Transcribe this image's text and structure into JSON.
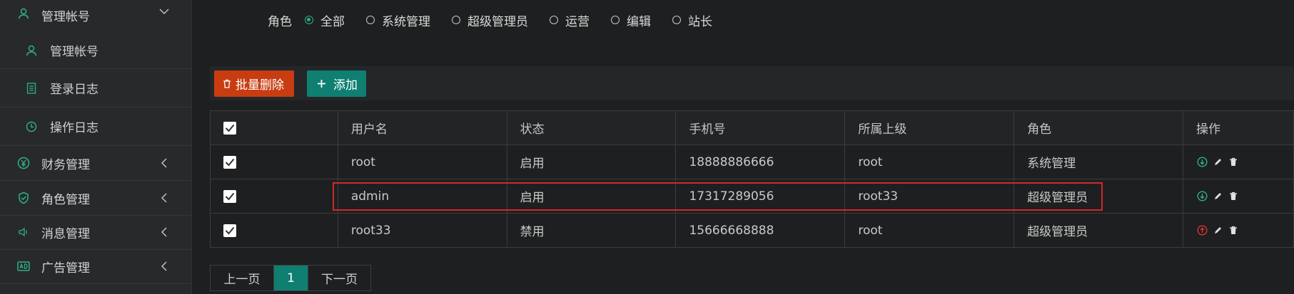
{
  "sidebar": {
    "top": {
      "label": "管理帐号",
      "icon": "user-icon"
    },
    "sub_items": [
      {
        "label": "管理帐号",
        "icon": "user-icon"
      },
      {
        "label": "登录日志",
        "icon": "document-icon"
      },
      {
        "label": "操作日志",
        "icon": "clock-icon"
      }
    ],
    "items": [
      {
        "label": "财务管理",
        "icon": "yen-icon"
      },
      {
        "label": "角色管理",
        "icon": "shield-check-icon"
      },
      {
        "label": "消息管理",
        "icon": "speaker-icon"
      },
      {
        "label": "广告管理",
        "icon": "ad-icon"
      }
    ]
  },
  "filter": {
    "label": "角色",
    "options": [
      "全部",
      "系统管理",
      "超级管理员",
      "运营",
      "编辑",
      "站长"
    ],
    "selected": "全部"
  },
  "toolbar": {
    "batch_delete": "批量删除",
    "add": "添加"
  },
  "table": {
    "headers": [
      "用户名",
      "状态",
      "手机号",
      "所属上级",
      "角色",
      "操作"
    ],
    "rows": [
      {
        "username": "root",
        "status": "启用",
        "phone": "18888886666",
        "parent": "root",
        "role": "系统管理",
        "state_icon": "download-icon"
      },
      {
        "username": "admin",
        "status": "启用",
        "phone": "17317289056",
        "parent": "root33",
        "role": "超级管理员",
        "state_icon": "download-icon"
      },
      {
        "username": "root33",
        "status": "禁用",
        "phone": "15666668888",
        "parent": "root",
        "role": "超级管理员",
        "state_icon": "upload-icon"
      }
    ]
  },
  "pager": {
    "prev": "上一页",
    "current": "1",
    "next": "下一页"
  },
  "colors": {
    "accent": "#2fb286",
    "delete_button": "#c83c12",
    "add_button": "#0f7f72",
    "highlight_border": "#d4262b",
    "disabled_icon": "#e03030"
  }
}
